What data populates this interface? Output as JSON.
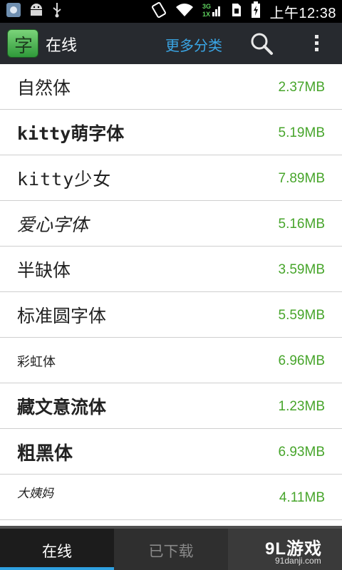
{
  "status_bar": {
    "time": "上午12:38",
    "icons": [
      "usb-debug-icon",
      "android-icon",
      "usb-icon",
      "rotation-lock-icon",
      "wifi-icon",
      "signal-3g-icon",
      "sim-icon",
      "battery-charging-icon"
    ]
  },
  "action_bar": {
    "title": "在线",
    "more_categories": "更多分类",
    "logo_glyph": "字",
    "search_icon": "search-icon",
    "overflow_icon": "overflow-menu-icon"
  },
  "fonts": [
    {
      "name": "自然体",
      "size": "2.37MB"
    },
    {
      "name": "kitty萌字体",
      "size": "5.19MB"
    },
    {
      "name": "kitty少女",
      "size": "7.89MB"
    },
    {
      "name": "爱心字体",
      "size": "5.16MB"
    },
    {
      "name": "半缺体",
      "size": "3.59MB"
    },
    {
      "name": "标准圆字体",
      "size": "5.59MB"
    },
    {
      "name": "彩虹体",
      "size": "6.96MB"
    },
    {
      "name": "藏文意流体",
      "size": "1.23MB"
    },
    {
      "name": "粗黑体",
      "size": "6.93MB"
    },
    {
      "name": "大姨妈",
      "size": "4.11MB"
    }
  ],
  "tabs": {
    "online": "在线",
    "downloaded": "已下载"
  },
  "watermark": {
    "logo": "9L游戏",
    "url": "91danji.com"
  },
  "colors": {
    "accent_blue": "#3aa6e6",
    "size_green": "#47a52b",
    "action_bar": "#272a2f"
  }
}
